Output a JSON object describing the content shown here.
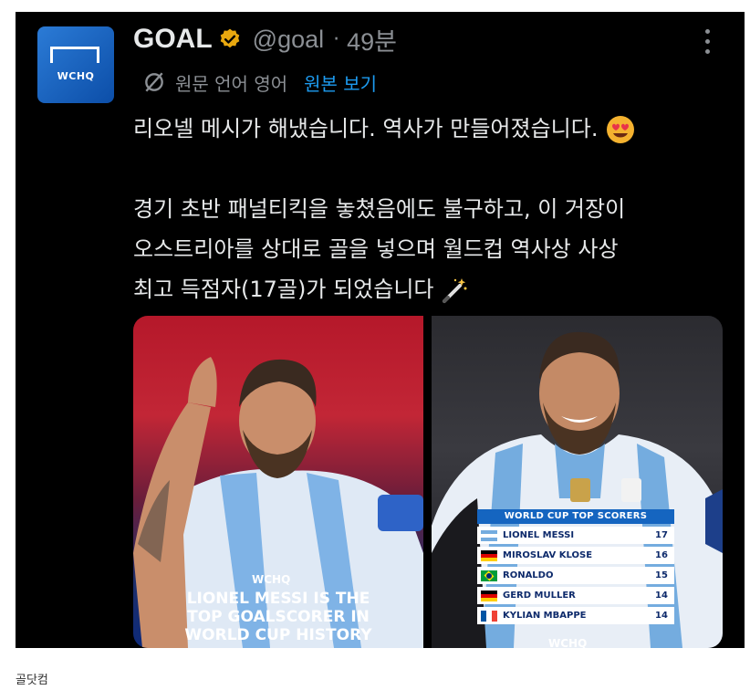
{
  "tweet": {
    "account": {
      "name": "GOAL",
      "handle": "@goal",
      "separator": "·",
      "time": "49분",
      "avatar_text": "WCHQ"
    },
    "translation": {
      "label": "원문 언어 영어",
      "link": "원본 보기"
    },
    "text": {
      "line1": "리오넬 메시가 해냈습니다. 역사가 만들어졌습니다.",
      "line2": "경기 초반 패널티킥을 놓쳤음에도 불구하고, 이 거장이",
      "line3": "오스트리아를 상대로 골을 넣으며 월드컵 역사상 사상",
      "line4": "최고 득점자(17골)가 되었습니다"
    },
    "media": {
      "image1": {
        "logo": "WCHQ",
        "caption_lines": [
          "LIONEL MESSI IS THE",
          "TOP GOALSCORER IN",
          "WORLD CUP HISTORY"
        ]
      },
      "image2": {
        "logo": "WCHQ",
        "table_title": "WORLD CUP TOP SCORERS",
        "rows": [
          {
            "player": "LIONEL MESSI",
            "goals": "17",
            "flag": "argentina"
          },
          {
            "player": "MIROSLAV KLOSE",
            "goals": "16",
            "flag": "germany"
          },
          {
            "player": "RONALDO",
            "goals": "15",
            "flag": "brazil"
          },
          {
            "player": "GERD MULLER",
            "goals": "14",
            "flag": "germany"
          },
          {
            "player": "KYLIAN MBAPPE",
            "goals": "14",
            "flag": "france"
          }
        ]
      }
    }
  },
  "footer": {
    "source": "골닷컴"
  },
  "colors": {
    "background": "#000000",
    "text": "#e7e9ea",
    "muted": "#8b8f94",
    "link": "#1d9bf0",
    "verified": "#e8a80f"
  },
  "icons": [
    "verified-badge-icon",
    "more-options-icon",
    "translate-icon",
    "heart-eyes-emoji",
    "magic-wand-emoji"
  ]
}
